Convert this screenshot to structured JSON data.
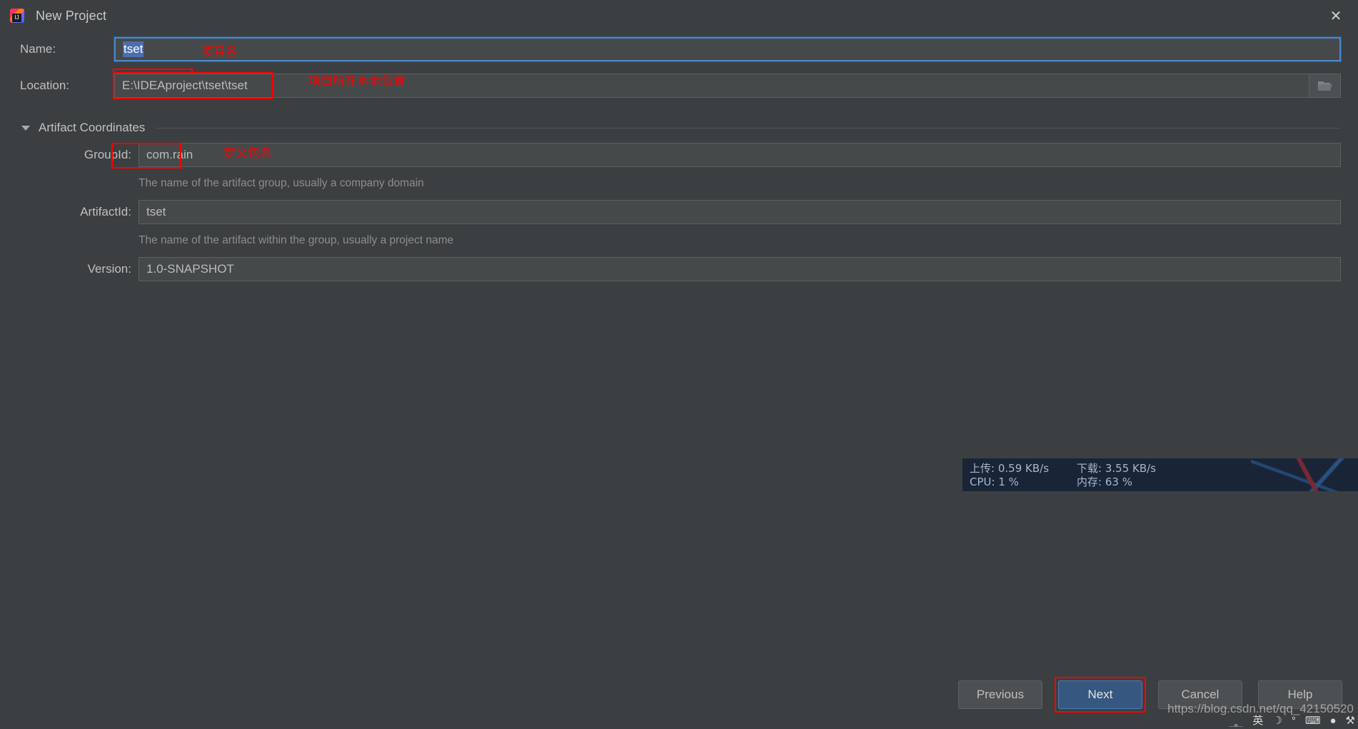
{
  "window": {
    "title": "New Project",
    "app_icon": "intellij-idea-icon",
    "close_label": "✕"
  },
  "form": {
    "name": {
      "label": "Name:",
      "value": "tset",
      "annotation": "项目名"
    },
    "location": {
      "label": "Location:",
      "value": "E:\\IDEAproject\\tset\\tset",
      "annotation": "项目所在本地位置",
      "browse_icon": "folder-open-icon"
    },
    "section": {
      "title": "Artifact Coordinates",
      "expanded": true,
      "toggle_icon": "chevron-down-icon"
    },
    "group_id": {
      "label": "GroupId:",
      "value": "com.rain",
      "hint": "The name of the artifact group, usually a company domain",
      "annotation": "定义包名"
    },
    "artifact_id": {
      "label": "ArtifactId:",
      "value": "tset",
      "hint": "The name of the artifact within the group, usually a project name"
    },
    "version": {
      "label": "Version:",
      "value": "1.0-SNAPSHOT"
    }
  },
  "buttons": {
    "previous": "Previous",
    "previous_mnemonic": "P",
    "next": "Next",
    "next_mnemonic": "N",
    "cancel": "Cancel",
    "help": "Help"
  },
  "network_monitor": {
    "upload_label": "上传:",
    "upload_value": "0.59 KB/s",
    "download_label": "下载:",
    "download_value": "3.55 KB/s",
    "cpu_label": "CPU:",
    "cpu_value": "1 %",
    "memory_label": "内存:",
    "memory_value": "63 %"
  },
  "watermark": "https://blog.csdn.net/qq_42150520",
  "tray": {
    "ime": "英",
    "moon_icon": "☽",
    "degree_icon": "°",
    "keyboard_icon": "⌨",
    "user_icon": "●",
    "wrench_icon": "⚒"
  },
  "colors": {
    "background": "#3c3f41",
    "field_bg": "#45494a",
    "accent_blue": "#4a88c7",
    "primary_button": "#365880",
    "annotation_red": "#ff0000",
    "selection_blue": "#4b6eaf"
  }
}
